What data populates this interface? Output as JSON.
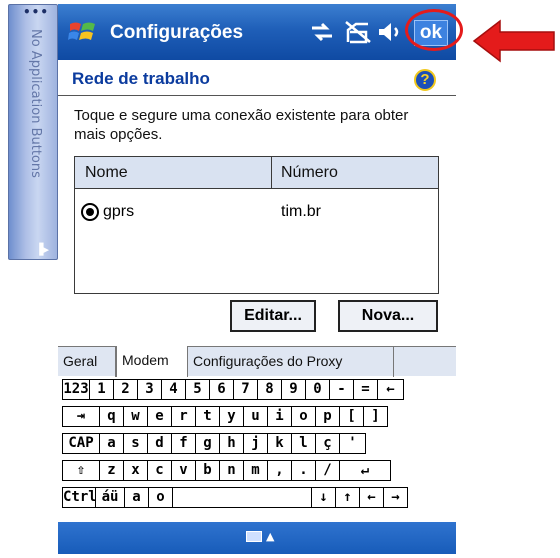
{
  "side_panel": {
    "label": "No Application Buttons"
  },
  "titlebar": {
    "title": "Configurações",
    "ok_label": "ok"
  },
  "header": {
    "title": "Rede de trabalho",
    "help_label": "?"
  },
  "description": "Toque e segure uma conexão existente para obter mais opções.",
  "list": {
    "columns": [
      "Nome",
      "Número"
    ],
    "rows": [
      {
        "name": "gprs",
        "number": "tim.br",
        "selected": true
      }
    ]
  },
  "buttons": {
    "edit": "Editar...",
    "new": "Nova..."
  },
  "tabs": [
    "Geral",
    "Modem",
    "Configurações do Proxy"
  ],
  "active_tab": "Modem",
  "keyboard": {
    "row1": [
      "123",
      "1",
      "2",
      "3",
      "4",
      "5",
      "6",
      "7",
      "8",
      "9",
      "0",
      "-",
      "=",
      "←"
    ],
    "row2": [
      "⇥",
      "q",
      "w",
      "e",
      "r",
      "t",
      "y",
      "u",
      "i",
      "o",
      "p",
      "[",
      "]"
    ],
    "row3": [
      "CAP",
      "a",
      "s",
      "d",
      "f",
      "g",
      "h",
      "j",
      "k",
      "l",
      "ç",
      "'"
    ],
    "row4": [
      "⇧",
      "z",
      "x",
      "c",
      "v",
      "b",
      "n",
      "m",
      ",",
      ".",
      "/",
      "↵"
    ],
    "row5": [
      "Ctrl",
      "áü",
      "a",
      "o",
      "",
      "↓",
      "↑",
      "←",
      "→"
    ]
  },
  "colors": {
    "titlebar": "#1f5fb8",
    "accent_red": "#e41b1b",
    "header_text": "#0b3b9e"
  },
  "icons": [
    "windows-start-icon",
    "connectivity-icon",
    "no-signal-icon",
    "volume-icon",
    "help-icon",
    "keyboard-icon"
  ]
}
